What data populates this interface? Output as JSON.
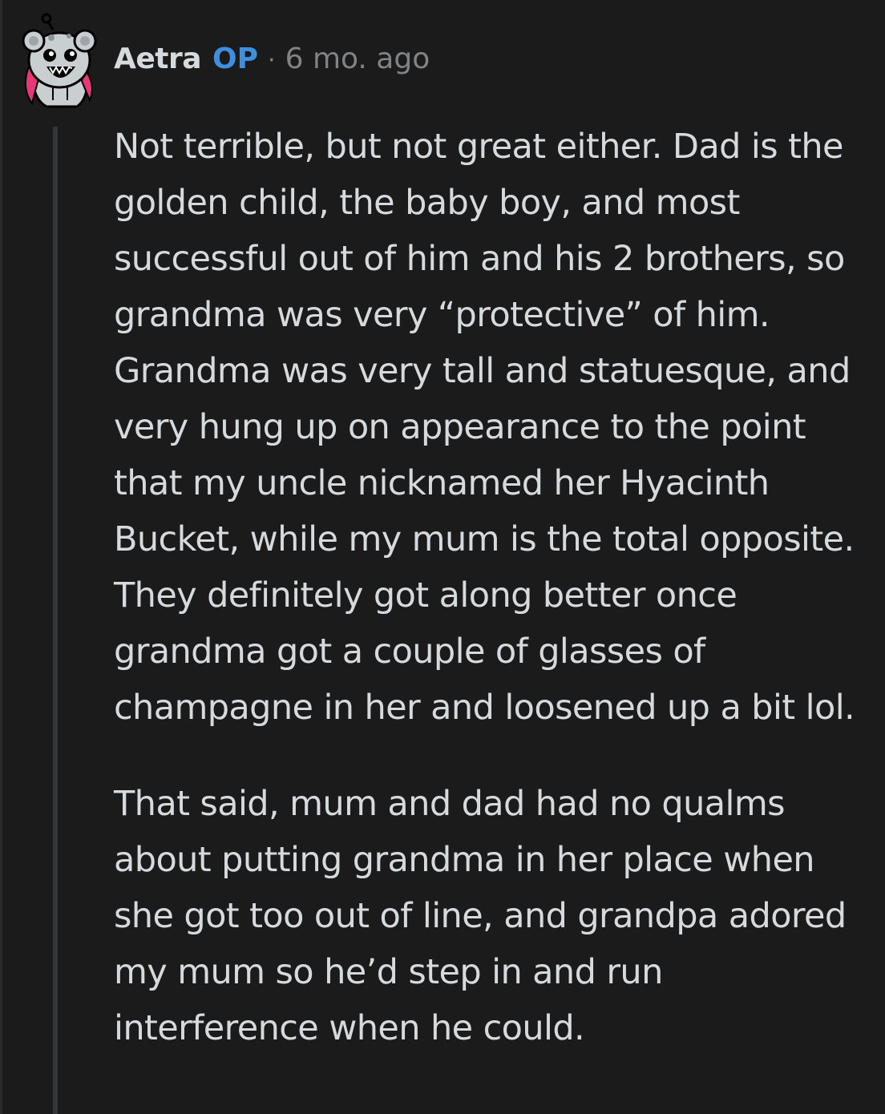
{
  "comment": {
    "author": "Aetra",
    "op_badge": "OP",
    "separator": "·",
    "timestamp": "6 mo. ago",
    "avatar_icon": "snoo-avatar-icon",
    "paragraphs": [
      "Not terrible, but not great either. Dad is the golden child, the baby boy, and most successful out of him and his 2 brothers, so grandma was very “protective” of him. Grandma was very tall and statuesque, and very hung up on appearance to the point that my uncle nicknamed her Hyacinth Bucket, while my mum is the total opposite. They definitely got along better once grandma got a couple of glasses of champagne in her and loosened up a bit lol.",
      "That said, mum and dad had no qualms about putting grandma in her place when she got too out of line, and grandpa adored my mum so he’d step in and run interference when he could."
    ]
  },
  "colors": {
    "background": "#1b1b1c",
    "text": "#d7dadc",
    "op": "#3d8fe0",
    "muted": "#818384",
    "thread_line": "#343536"
  }
}
